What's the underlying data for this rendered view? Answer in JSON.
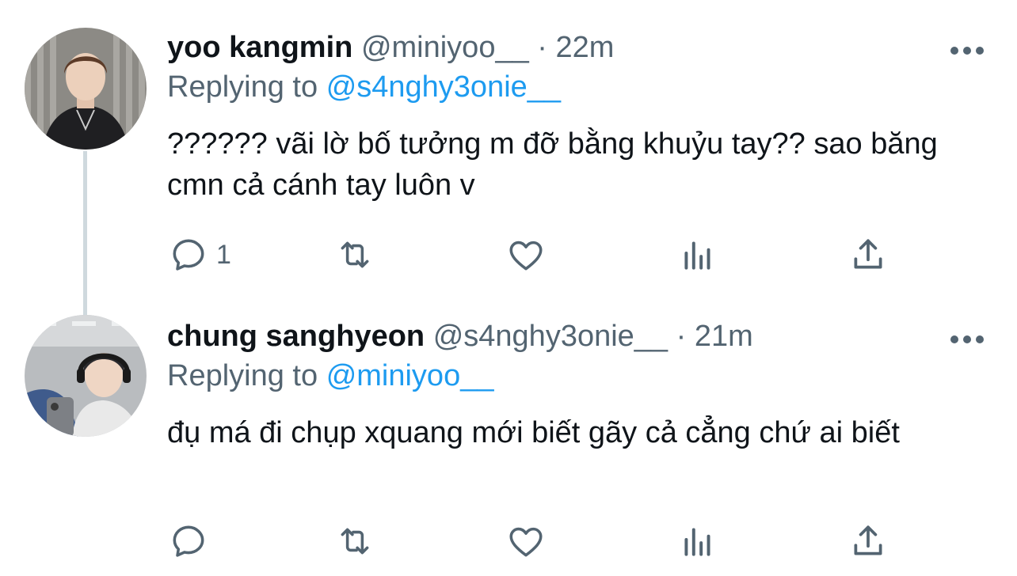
{
  "tweets": [
    {
      "display_name": "yoo kangmin",
      "handle": "@miniyoo__",
      "separator": "·",
      "time": "22m",
      "replying_prefix": "Replying to",
      "replying_to": "@s4nghy3onie__",
      "text": "?????? vãi lờ bố tưởng m đỡ bằng khuỷu tay?? sao băng cmn cả cánh tay luôn v",
      "reply_count": "1",
      "icons": [
        "reply-icon",
        "retweet-icon",
        "like-icon",
        "views-icon",
        "share-icon",
        "more-icon"
      ]
    },
    {
      "display_name": "chung sanghyeon",
      "handle": "@s4nghy3onie__",
      "separator": "·",
      "time": "21m",
      "replying_prefix": "Replying to",
      "replying_to": "@miniyoo__",
      "text": "đụ má đi chụp xquang mới biết gãy cả cẳng chứ ai biết",
      "reply_count": "",
      "icons": [
        "reply-icon",
        "retweet-icon",
        "like-icon",
        "views-icon",
        "share-icon",
        "more-icon"
      ]
    }
  ],
  "colors": {
    "text": "#0f1419",
    "secondary": "#536471",
    "link": "#1d9bf0",
    "thread_line": "#cfd9de"
  }
}
